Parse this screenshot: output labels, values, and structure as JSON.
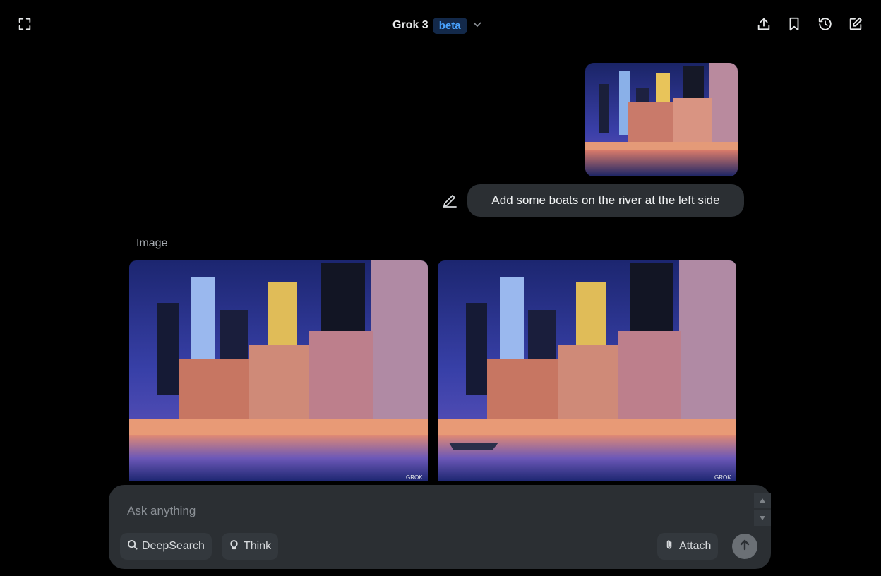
{
  "header": {
    "model_name": "Grok 3",
    "badge": "beta",
    "icons": [
      "expand-icon",
      "share-icon",
      "bookmark-icon",
      "history-icon",
      "new-chat-icon"
    ]
  },
  "conversation": {
    "user_message": "Add some boats on the river at the left side",
    "response_label": "Image",
    "watermark": "GROK"
  },
  "composer": {
    "placeholder": "Ask anything",
    "deepsearch_label": "DeepSearch",
    "think_label": "Think",
    "attach_label": "Attach"
  },
  "colors": {
    "background": "#000000",
    "bubble": "#2b2f33",
    "badge_bg": "#13294a",
    "badge_text": "#4aa3ff"
  }
}
